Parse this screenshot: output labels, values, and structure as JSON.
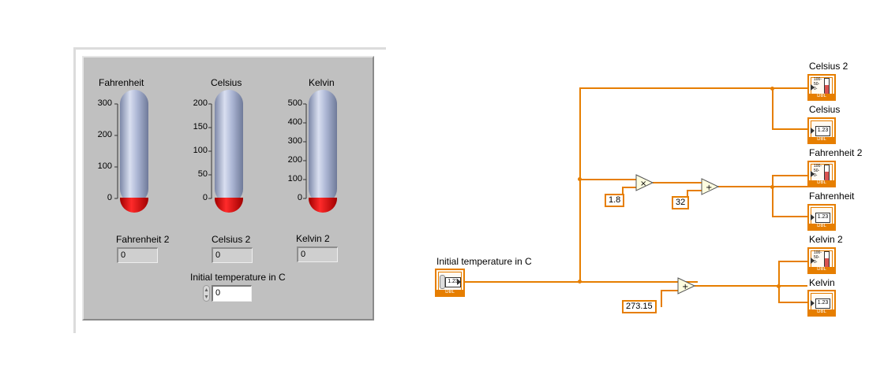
{
  "front_panel": {
    "thermometers": [
      {
        "label": "Fahrenheit",
        "ticks": [
          "300",
          "200",
          "100",
          "0"
        ],
        "value": 0,
        "max": 300
      },
      {
        "label": "Celsius",
        "ticks": [
          "200",
          "150",
          "100",
          "50",
          "0"
        ],
        "value": 0,
        "max": 200
      },
      {
        "label": "Kelvin",
        "ticks": [
          "500",
          "400",
          "300",
          "200",
          "100",
          "0"
        ],
        "value": 0,
        "max": 500
      }
    ],
    "indicators": [
      {
        "label": "Fahrenheit 2",
        "value": "0"
      },
      {
        "label": "Celsius 2",
        "value": "0"
      },
      {
        "label": "Kelvin 2",
        "value": "0"
      }
    ],
    "control": {
      "label": "Initial temperature in C",
      "value": "0"
    },
    "colors": {
      "panel": "#c0c0c0",
      "mercury": "#e00000",
      "tube": "#a9b4d4"
    }
  },
  "block_diagram": {
    "control_label": "Initial temperature in C",
    "control_value_glyph": "1.23",
    "type_tag": "DBL",
    "constants": [
      "1.8",
      "32",
      "273.15"
    ],
    "operators": [
      "×",
      "+",
      "+"
    ],
    "terminals": [
      {
        "label": "Celsius  2",
        "kind": "thermometer"
      },
      {
        "label": "Celsius",
        "kind": "numeric"
      },
      {
        "label": "Fahrenheit  2",
        "kind": "thermometer"
      },
      {
        "label": "Fahrenheit",
        "kind": "numeric"
      },
      {
        "label": "Kelvin 2",
        "kind": "thermometer"
      },
      {
        "label": "Kelvin",
        "kind": "numeric"
      }
    ],
    "gauge_scale": [
      "100-",
      "50-",
      "0-"
    ],
    "wire_color": "#e67e00"
  }
}
